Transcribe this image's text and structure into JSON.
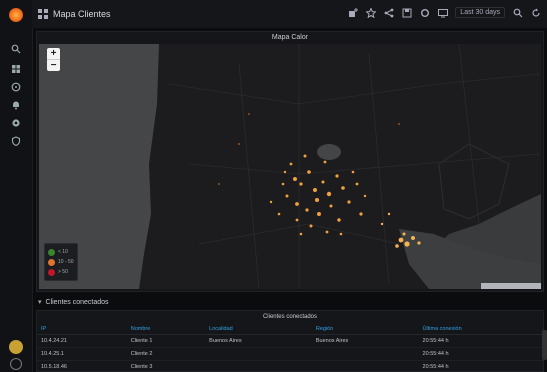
{
  "topbar": {
    "dashboard_title": "Mapa Clientes",
    "time_range": "Last 30 days"
  },
  "map_panel": {
    "title": "Mapa Calor",
    "zoom_in": "+",
    "zoom_out": "−",
    "legend": [
      {
        "label": "< 10",
        "color": "#37872d"
      },
      {
        "label": "10 - 50",
        "color": "#e0752d"
      },
      {
        "label": "> 50",
        "color": "#c4162a"
      }
    ]
  },
  "row": {
    "title": "Clientes conectados"
  },
  "table": {
    "title": "Clientes conectados",
    "columns": [
      "IP",
      "Nombre",
      "Localidad",
      "Región",
      "Última conexión"
    ],
    "rows": [
      [
        "10.4.24.21",
        "Cliente 1",
        "Buenos Aires",
        "Buenos Aires",
        "20:55:44 h"
      ],
      [
        "10.4.25.1",
        "Cliente 2",
        "",
        "",
        "20:55:44 h"
      ],
      [
        "10.5.18.46",
        "Cliente 3",
        "",
        "",
        "20:55:44 h"
      ]
    ]
  },
  "colors": {
    "accent": "#33a2e5",
    "heat": "#f2a03c",
    "background": "#0b0c0e"
  }
}
